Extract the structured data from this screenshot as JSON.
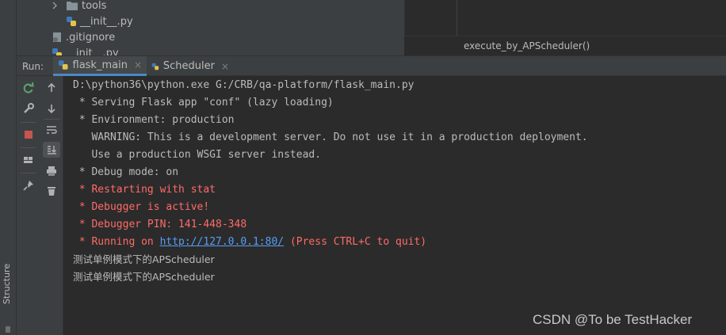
{
  "sidebar": {
    "structure_label": "Structure"
  },
  "project_tree": {
    "items": [
      {
        "label": "tools",
        "icon": "folder-icon"
      },
      {
        "label": "__init__.py",
        "icon": "python-file-icon"
      },
      {
        "label": ".gitignore",
        "icon": "gitignore-file-icon"
      },
      {
        "label": "__init__.py",
        "icon": "python-file-icon"
      }
    ]
  },
  "editor": {
    "breadcrumb": "execute_by_APScheduler()"
  },
  "run_panel": {
    "label": "Run:",
    "tabs": [
      {
        "label": "flask_main",
        "active": true
      },
      {
        "label": "Scheduler",
        "active": false
      }
    ],
    "close_glyph": "×"
  },
  "console": {
    "lines": [
      {
        "text": "D:\\python36\\python.exe G:/CRB/qa-platform/flask_main.py",
        "color": "normal"
      },
      {
        "text": " * Serving Flask app \"conf\" (lazy loading)",
        "color": "normal"
      },
      {
        "text": " * Environment: production",
        "color": "normal"
      },
      {
        "text": "   WARNING: This is a development server. Do not use it in a production deployment.",
        "color": "normal"
      },
      {
        "text": "   Use a production WSGI server instead.",
        "color": "normal"
      },
      {
        "text": " * Debug mode: on",
        "color": "normal"
      },
      {
        "text": " * Restarting with stat",
        "color": "red"
      },
      {
        "text": " * Debugger is active!",
        "color": "red"
      },
      {
        "text": " * Debugger PIN: 141-448-348",
        "color": "red"
      },
      {
        "text": "测试单例模式下的APScheduler",
        "color": "normal"
      },
      {
        "text": "测试单例模式下的APScheduler",
        "color": "normal"
      }
    ],
    "running_line": {
      "prefix": " * Running on ",
      "link": "http://127.0.0.1:80/",
      "suffix": " (Press CTRL+C to quit)"
    }
  },
  "watermark": "CSDN @To be TestHacker",
  "colors": {
    "background": "#2b2b2b",
    "panel": "#3c3f41",
    "text": "#bbbbbb",
    "error_red": "#ff6b68",
    "link_blue": "#589df6",
    "tab_underline": "#4a88c7"
  }
}
